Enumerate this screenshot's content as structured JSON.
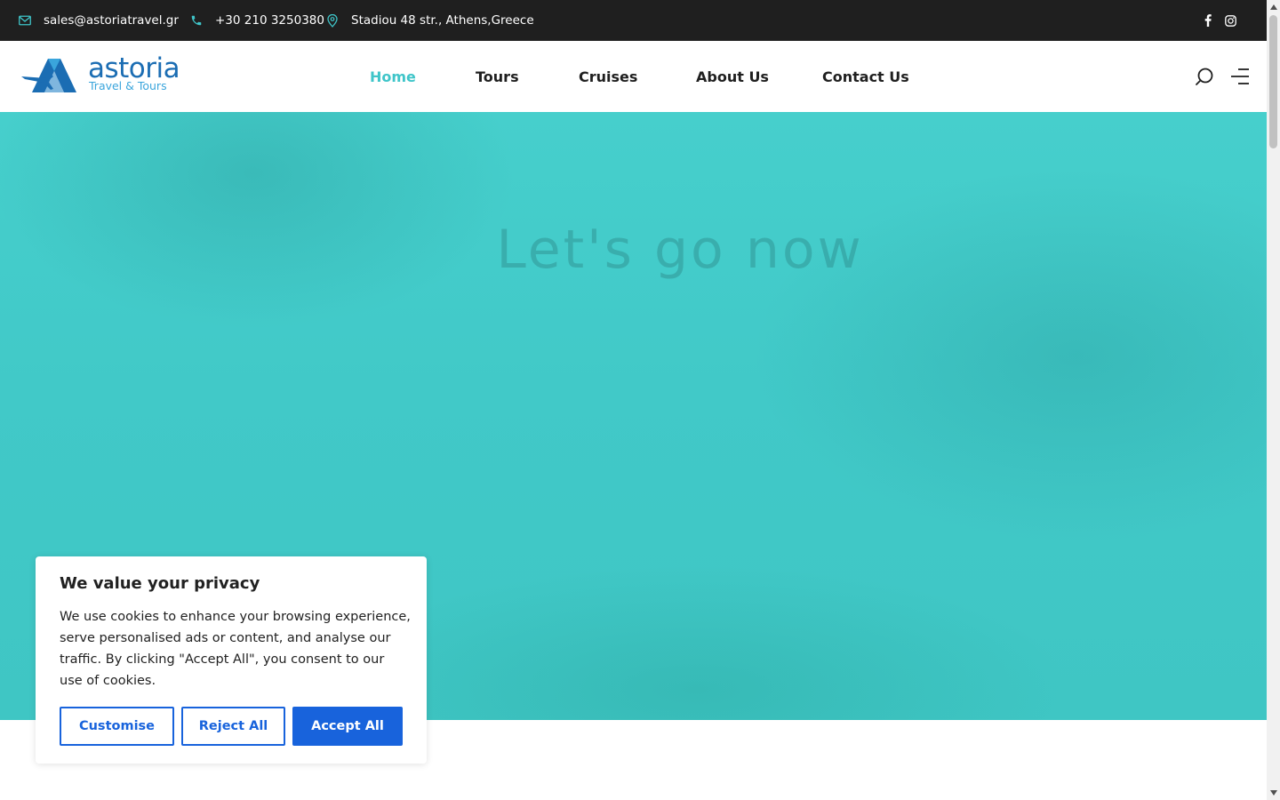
{
  "topbar": {
    "email": "sales@astoriatravel.gr",
    "phone": "+30 210 3250380",
    "address": "Stadiou 48 str., Athens,Greece",
    "icons": [
      "mail-icon",
      "phone-icon",
      "location-pin-icon",
      "facebook-icon",
      "instagram-icon"
    ]
  },
  "logo": {
    "name": "astoria",
    "tagline": "Travel & Tours"
  },
  "nav": {
    "items": [
      {
        "label": "Home",
        "active": true
      },
      {
        "label": "Tours",
        "active": false
      },
      {
        "label": "Cruises",
        "active": false
      },
      {
        "label": "About Us",
        "active": false
      },
      {
        "label": "Contact Us",
        "active": false
      }
    ],
    "icons": [
      "search-icon",
      "menu-icon"
    ]
  },
  "hero": {
    "title": "Let's go now"
  },
  "cookie": {
    "title": "We value your privacy",
    "text": "We use cookies to enhance your browsing experience, serve personalised ads or content, and analyse our traffic. By clicking \"Accept All\", you consent to our use of cookies.",
    "customise": "Customise",
    "reject": "Reject All",
    "accept": "Accept All"
  },
  "colors": {
    "accent": "#3fc5c9",
    "topbar": "#1f1f1f",
    "button": "#1863dc",
    "logo": "#1b6db3"
  }
}
